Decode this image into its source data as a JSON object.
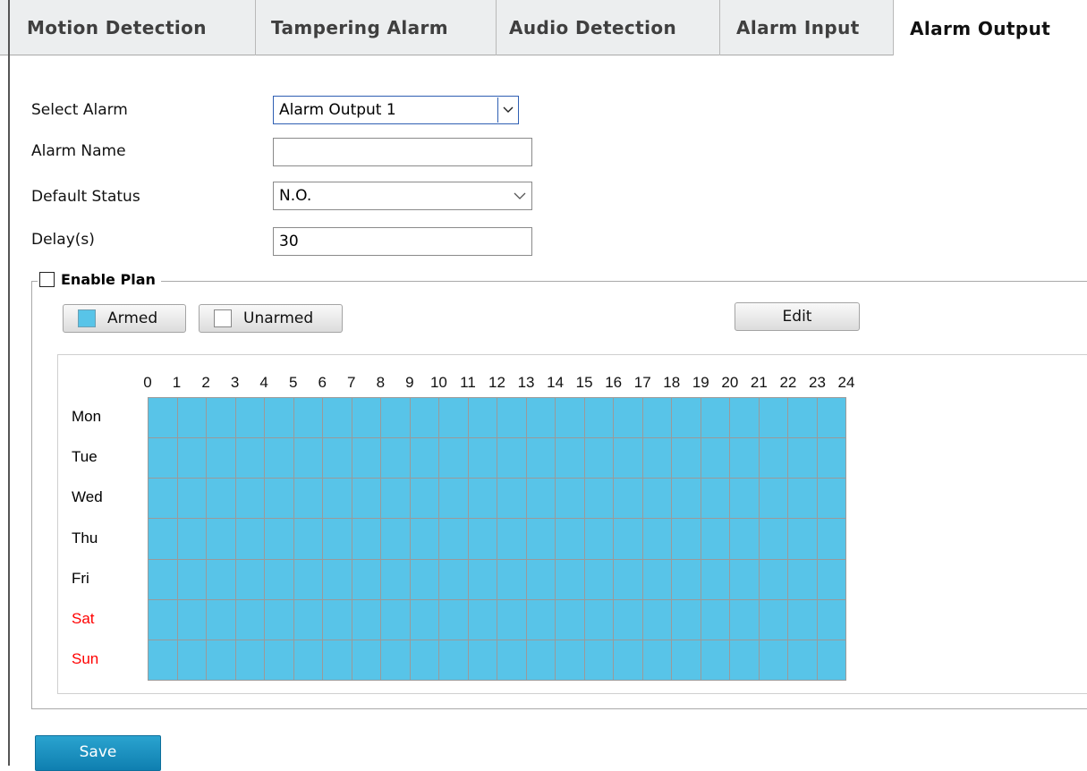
{
  "tabs": [
    {
      "label": "Motion Detection",
      "active": false
    },
    {
      "label": "Tampering Alarm",
      "active": false
    },
    {
      "label": "Audio Detection",
      "active": false
    },
    {
      "label": "Alarm Input",
      "active": false
    },
    {
      "label": "Alarm Output",
      "active": true
    }
  ],
  "form": {
    "select_alarm": {
      "label": "Select Alarm",
      "value": "Alarm Output 1"
    },
    "alarm_name": {
      "label": "Alarm Name",
      "value": ""
    },
    "default_status": {
      "label": "Default Status",
      "value": "N.O."
    },
    "delay": {
      "label": "Delay(s)",
      "value": "30"
    }
  },
  "plan": {
    "enable_label": "Enable Plan",
    "enabled": false,
    "armed_label": "Armed",
    "unarmed_label": "Unarmed",
    "edit_label": "Edit",
    "hours": [
      "0",
      "1",
      "2",
      "3",
      "4",
      "5",
      "6",
      "7",
      "8",
      "9",
      "10",
      "11",
      "12",
      "13",
      "14",
      "15",
      "16",
      "17",
      "18",
      "19",
      "20",
      "21",
      "22",
      "23",
      "24"
    ],
    "days": [
      {
        "label": "Mon",
        "weekend": false
      },
      {
        "label": "Tue",
        "weekend": false
      },
      {
        "label": "Wed",
        "weekend": false
      },
      {
        "label": "Thu",
        "weekend": false
      },
      {
        "label": "Fri",
        "weekend": false
      },
      {
        "label": "Sat",
        "weekend": true
      },
      {
        "label": "Sun",
        "weekend": true
      }
    ],
    "all_armed": true
  },
  "save_label": "Save",
  "colors": {
    "armed": "#58c4e8",
    "weekend_text": "#ff0000",
    "save_button": "#1a8fc0"
  },
  "icons": {
    "dropdown": "chevron-down-icon",
    "checkbox": "checkbox-unchecked-icon"
  }
}
